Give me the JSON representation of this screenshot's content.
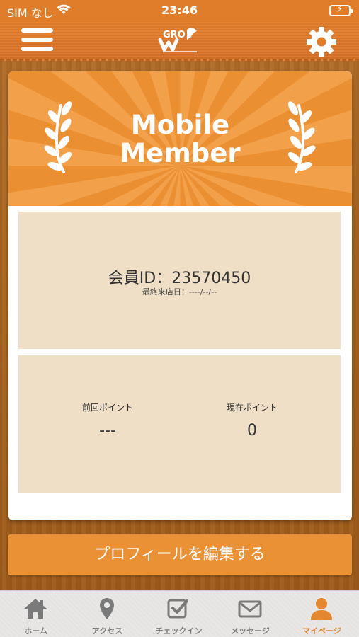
{
  "status_bar": {
    "carrier": "SIM なし",
    "time": "23:46"
  },
  "nav": {
    "logo_text": "GRO",
    "logo_icon": "grow-logo",
    "menu_icon": "hamburger-menu-icon",
    "settings_icon": "gear-icon"
  },
  "card": {
    "title": "Mobile\nMember",
    "member_id": "会員ID：23570450",
    "last_visit": "最終来店日：----/--/--",
    "points": {
      "previous_label": "前回ポイント",
      "previous_value": "---",
      "current_label": "現在ポイント",
      "current_value": "0"
    }
  },
  "edit_profile_label": "プロフィールを編集する",
  "tabs": [
    {
      "label": "ホーム",
      "icon": "home-icon",
      "active": false
    },
    {
      "label": "アクセス",
      "icon": "map-pin-icon",
      "active": false
    },
    {
      "label": "チェックイン",
      "icon": "checkin-icon",
      "active": false
    },
    {
      "label": "メッセージ",
      "icon": "mail-icon",
      "active": false
    },
    {
      "label": "マイページ",
      "icon": "person-icon",
      "active": true
    }
  ],
  "colors": {
    "accent": "#ea9035",
    "active_tab": "#e3882e",
    "panel": "#efdfc6"
  }
}
